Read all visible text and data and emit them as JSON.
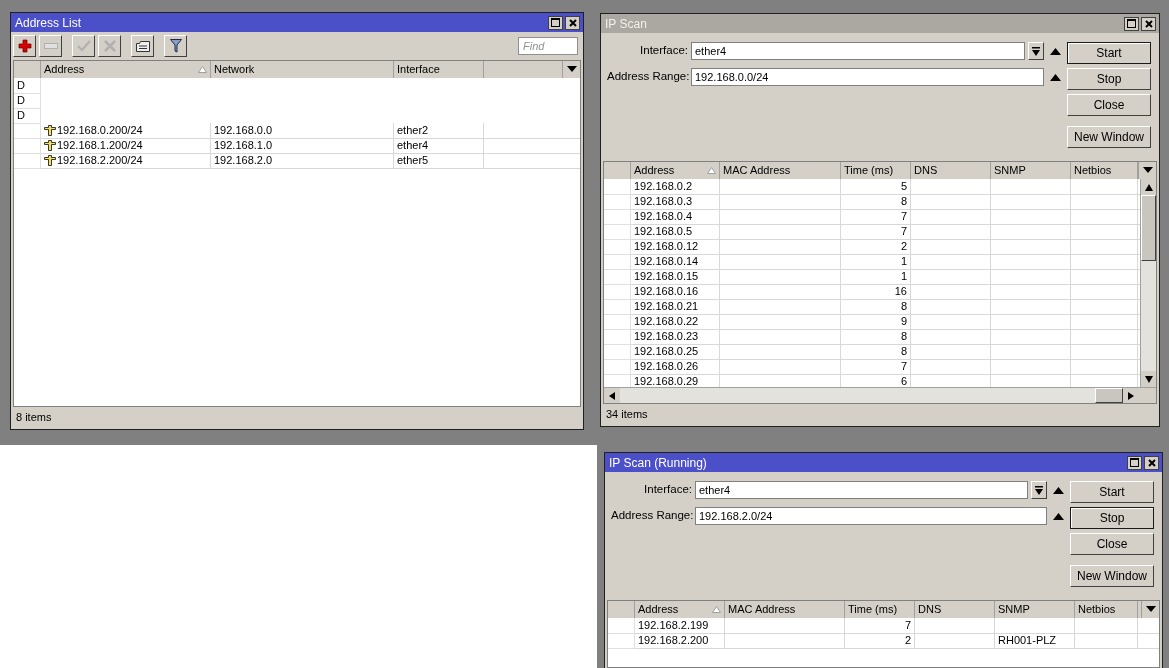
{
  "windows": [
    {
      "kind": "address_list",
      "title": "Address List",
      "active": true,
      "toolbar": [
        {
          "kind": "add",
          "disabled": false
        },
        {
          "kind": "remove",
          "disabled": true
        },
        {
          "kind": "enable",
          "disabled": true
        },
        {
          "kind": "disable",
          "disabled": true
        },
        {
          "kind": "comment",
          "disabled": false
        },
        {
          "kind": "filter",
          "disabled": false
        }
      ],
      "find": {
        "placeholder": "Find"
      },
      "columns": [
        {
          "label": "Address",
          "sorted": true
        },
        {
          "label": "Network",
          "sorted": false
        },
        {
          "label": "Interface",
          "sorted": false
        }
      ],
      "rows": [
        {
          "kind": "flag",
          "flag": "D"
        },
        {
          "kind": "flag",
          "flag": "D"
        },
        {
          "kind": "flag",
          "flag": "D"
        },
        {
          "kind": "address",
          "address": "192.168.0.200/24",
          "network": "192.168.0.0",
          "interface": "ether2"
        },
        {
          "kind": "address",
          "address": "192.168.1.200/24",
          "network": "192.168.1.0",
          "interface": "ether4"
        },
        {
          "kind": "address",
          "address": "192.168.2.200/24",
          "network": "192.168.2.0",
          "interface": "ether5"
        }
      ],
      "status": "8 items"
    },
    {
      "kind": "ip_scan",
      "title": "IP Scan",
      "active": false,
      "fields": [
        {
          "label": "Interface:",
          "value": "ether4",
          "dropdown": true
        },
        {
          "label": "Address Range:",
          "value": "192.168.0.0/24",
          "dropdown": false
        }
      ],
      "buttons": [
        {
          "label": "Start",
          "default": true
        },
        {
          "label": "Stop",
          "default": false
        },
        {
          "label": "Close",
          "default": false
        },
        {
          "label": "New Window",
          "default": false
        }
      ],
      "columns": [
        {
          "label": "Address",
          "sorted": true
        },
        {
          "label": "MAC Address",
          "sorted": false
        },
        {
          "label": "Time (ms)",
          "sorted": false
        },
        {
          "label": "DNS",
          "sorted": false
        },
        {
          "label": "SNMP",
          "sorted": false
        },
        {
          "label": "Netbios",
          "sorted": false
        }
      ],
      "rows": [
        {
          "address": "192.168.0.2",
          "time": "5"
        },
        {
          "address": "192.168.0.3",
          "time": "8"
        },
        {
          "address": "192.168.0.4",
          "time": "7"
        },
        {
          "address": "192.168.0.5",
          "time": "7"
        },
        {
          "address": "192.168.0.12",
          "time": "2"
        },
        {
          "address": "192.168.0.14",
          "time": "1"
        },
        {
          "address": "192.168.0.15",
          "time": "1"
        },
        {
          "address": "192.168.0.16",
          "time": "16"
        },
        {
          "address": "192.168.0.21",
          "time": "8"
        },
        {
          "address": "192.168.0.22",
          "time": "9"
        },
        {
          "address": "192.168.0.23",
          "time": "8"
        },
        {
          "address": "192.168.0.25",
          "time": "8"
        },
        {
          "address": "192.168.0.26",
          "time": "7"
        },
        {
          "address": "192.168.0.29",
          "time": "6"
        }
      ],
      "status": "34 items"
    },
    {
      "kind": "ip_scan",
      "title": "IP Scan (Running)",
      "active": true,
      "fields": [
        {
          "label": "Interface:",
          "value": "ether4",
          "dropdown": true
        },
        {
          "label": "Address Range:",
          "value": "192.168.2.0/24",
          "dropdown": false
        }
      ],
      "buttons": [
        {
          "label": "Start",
          "default": false
        },
        {
          "label": "Stop",
          "default": true
        },
        {
          "label": "Close",
          "default": false
        },
        {
          "label": "New Window",
          "default": false
        }
      ],
      "columns": [
        {
          "label": "Address",
          "sorted": true
        },
        {
          "label": "MAC Address",
          "sorted": false
        },
        {
          "label": "Time (ms)",
          "sorted": false
        },
        {
          "label": "DNS",
          "sorted": false
        },
        {
          "label": "SNMP",
          "sorted": false
        },
        {
          "label": "Netbios",
          "sorted": false
        }
      ],
      "rows": [
        {
          "address": "192.168.2.199",
          "time": "7"
        },
        {
          "address": "192.168.2.200",
          "time": "2",
          "snmp": "RH001-PLZ"
        }
      ]
    }
  ]
}
